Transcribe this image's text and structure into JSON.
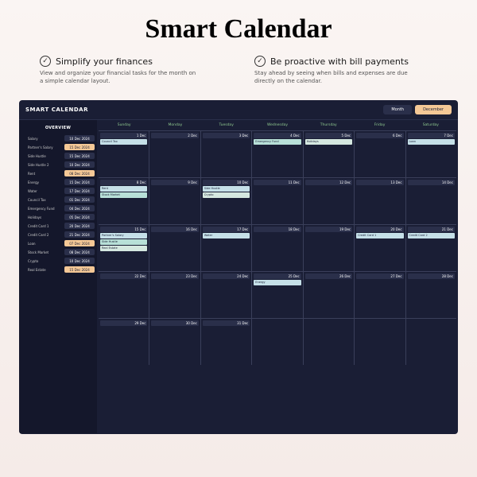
{
  "page_title": "Smart Calendar",
  "features": [
    {
      "title": "Simplify your finances",
      "desc": "View and organize your financial tasks for the month on a simple calendar layout."
    },
    {
      "title": "Be proactive with bill payments",
      "desc": "Stay ahead by seeing when bills and expenses are due directly on the calendar."
    }
  ],
  "app": {
    "title": "SMART CALENDAR",
    "view_label": "Month",
    "month_label": "December"
  },
  "overview": {
    "title": "OVERVIEW",
    "items": [
      {
        "label": "Salary",
        "date": "10 Dec 2024",
        "cls": "d-dark"
      },
      {
        "label": "Partner's Salary",
        "date": "15 Dec 2024",
        "cls": "d-orange"
      },
      {
        "label": "Side Hustle",
        "date": "15 Dec 2024",
        "cls": "d-dark"
      },
      {
        "label": "Side Hustle 2",
        "date": "10 Dec 2024",
        "cls": "d-dark"
      },
      {
        "label": "Rent",
        "date": "08 Dec 2024",
        "cls": "d-orange"
      },
      {
        "label": "Energy",
        "date": "15 Dec 2024",
        "cls": "d-dark"
      },
      {
        "label": "Water",
        "date": "17 Dec 2024",
        "cls": "d-dark"
      },
      {
        "label": "Council Tax",
        "date": "01 Dec 2024",
        "cls": "d-dark"
      },
      {
        "label": "Emergency Fund",
        "date": "04 Dec 2024",
        "cls": "d-dark"
      },
      {
        "label": "Holidays",
        "date": "05 Dec 2024",
        "cls": "d-dark"
      },
      {
        "label": "Credit Card 1",
        "date": "20 Dec 2024",
        "cls": "d-dark"
      },
      {
        "label": "Credit Card 2",
        "date": "21 Dec 2024",
        "cls": "d-dark"
      },
      {
        "label": "Loan",
        "date": "07 Dec 2024",
        "cls": "d-orange"
      },
      {
        "label": "Stock Market",
        "date": "08 Dec 2024",
        "cls": "d-dark"
      },
      {
        "label": "Crypto",
        "date": "10 Dec 2024",
        "cls": "d-dark"
      },
      {
        "label": "Real Estate",
        "date": "15 Dec 2024",
        "cls": "d-orange"
      }
    ]
  },
  "calendar": {
    "days": [
      "Sunday",
      "Monday",
      "Tuesday",
      "Wednesday",
      "Thursday",
      "Friday",
      "Saturday"
    ],
    "weeks": [
      [
        {
          "date": "1 Dec",
          "events": [
            {
              "t": "Council Tax",
              "c": "e-blue"
            }
          ]
        },
        {
          "date": "2 Dec",
          "events": []
        },
        {
          "date": "3 Dec",
          "events": []
        },
        {
          "date": "4 Dec",
          "events": [
            {
              "t": "Emergency Fund",
              "c": "e-mint"
            }
          ]
        },
        {
          "date": "5 Dec",
          "events": [
            {
              "t": "Holidays",
              "c": "e-pale"
            }
          ]
        },
        {
          "date": "6 Dec",
          "events": []
        },
        {
          "date": "7 Dec",
          "events": [
            {
              "t": "Loan",
              "c": "e-blue"
            }
          ]
        }
      ],
      [
        {
          "date": "8 Dec",
          "events": [
            {
              "t": "Rent",
              "c": "e-blue"
            },
            {
              "t": "Stock Market",
              "c": "e-mint"
            }
          ]
        },
        {
          "date": "9 Dec",
          "events": []
        },
        {
          "date": "10 Dec",
          "events": [
            {
              "t": "Side Hustle",
              "c": "e-blue"
            },
            {
              "t": "Crypto",
              "c": "e-pale"
            }
          ]
        },
        {
          "date": "11 Dec",
          "events": []
        },
        {
          "date": "12 Dec",
          "events": []
        },
        {
          "date": "13 Dec",
          "events": []
        },
        {
          "date": "14 Dec",
          "events": []
        }
      ],
      [
        {
          "date": "15 Dec",
          "events": [
            {
              "t": "Partner's Salary",
              "c": "e-blue"
            },
            {
              "t": "Side Hustle",
              "c": "e-mint"
            },
            {
              "t": "Real Estate",
              "c": "e-pale"
            }
          ]
        },
        {
          "date": "16 Dec",
          "events": []
        },
        {
          "date": "17 Dec",
          "events": [
            {
              "t": "Water",
              "c": "e-blue"
            }
          ]
        },
        {
          "date": "18 Dec",
          "events": []
        },
        {
          "date": "19 Dec",
          "events": []
        },
        {
          "date": "20 Dec",
          "events": [
            {
              "t": "Credit Card 1",
              "c": "e-blue"
            }
          ]
        },
        {
          "date": "21 Dec",
          "events": [
            {
              "t": "Credit Card 2",
              "c": "e-blue"
            }
          ]
        }
      ],
      [
        {
          "date": "22 Dec",
          "events": []
        },
        {
          "date": "23 Dec",
          "events": []
        },
        {
          "date": "24 Dec",
          "events": []
        },
        {
          "date": "25 Dec",
          "events": [
            {
              "t": "Energy",
              "c": "e-blue"
            }
          ]
        },
        {
          "date": "26 Dec",
          "events": []
        },
        {
          "date": "27 Dec",
          "events": []
        },
        {
          "date": "28 Dec",
          "events": []
        }
      ],
      [
        {
          "date": "29 Dec",
          "events": []
        },
        {
          "date": "30 Dec",
          "events": []
        },
        {
          "date": "31 Dec",
          "events": []
        },
        {
          "date": "",
          "events": []
        },
        {
          "date": "",
          "events": []
        },
        {
          "date": "",
          "events": []
        },
        {
          "date": "",
          "events": []
        }
      ]
    ]
  }
}
